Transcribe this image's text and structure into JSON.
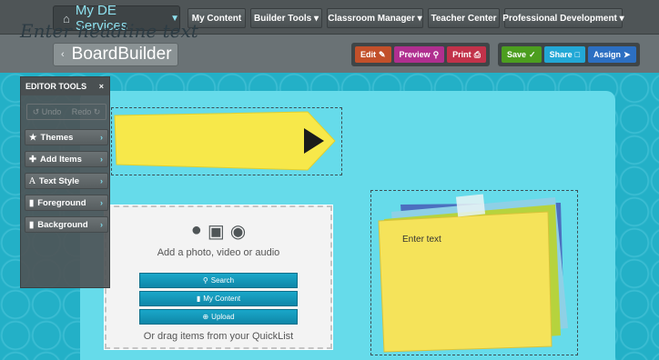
{
  "topnav": {
    "brand_label": "My DE Services",
    "items": [
      "My Content",
      "Builder Tools",
      "Classroom Manager",
      "Teacher Center",
      "Professional Development"
    ]
  },
  "subbar": {
    "logo": "BoardBuilder",
    "actions": [
      {
        "label": "Edit",
        "icon": "pencil-icon",
        "color": "#c2502a"
      },
      {
        "label": "Preview",
        "icon": "search-icon",
        "color": "#b02f8f"
      },
      {
        "label": "Print",
        "icon": "printer-icon",
        "color": "#c2324a"
      },
      {
        "label": "Save",
        "icon": "save-icon",
        "color": "#4c9e1f"
      },
      {
        "label": "Share",
        "icon": "share-icon",
        "color": "#22a8d6"
      },
      {
        "label": "Assign",
        "icon": "assign-icon",
        "color": "#2c6fc2"
      }
    ]
  },
  "editor_tools": {
    "title": "EDITOR TOOLS",
    "close": "×",
    "undo": "Undo",
    "redo": "Redo",
    "items": [
      "Themes",
      "Add Items",
      "Text Style",
      "Foreground",
      "Background"
    ]
  },
  "headline": {
    "text": "Enter headline text"
  },
  "media": {
    "prompt": "Add a photo, video or audio",
    "buttons": [
      "Search",
      "My Content",
      "Upload"
    ],
    "footer": "Or drag items from your QuickList"
  },
  "sticky": {
    "text": "Enter text"
  },
  "colors": {
    "accent": "#2bb3c9",
    "banner": "#f7e84a",
    "sticky": "#f5e35a"
  }
}
